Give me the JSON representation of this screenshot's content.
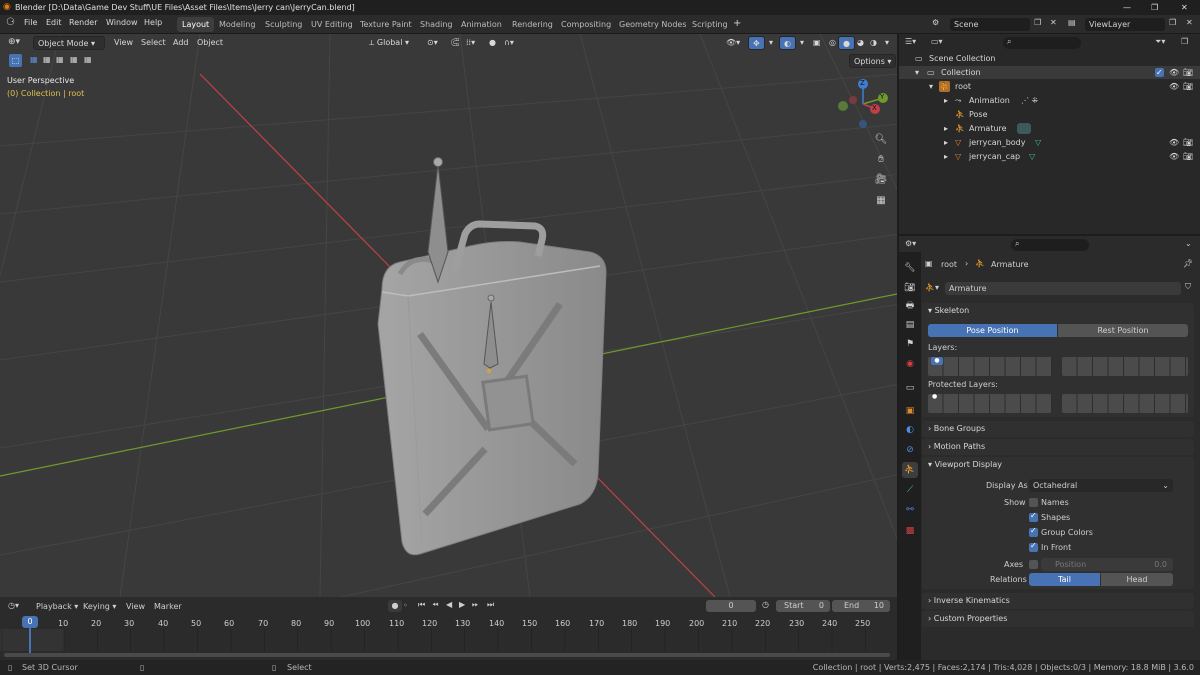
{
  "window": {
    "title": "Blender [D:\\Data\\Game Dev Stuff\\UE Files\\Asset Files\\Items\\Jerry can\\JerryCan.blend]"
  },
  "menu": [
    "File",
    "Edit",
    "Render",
    "Window",
    "Help"
  ],
  "workspaces": [
    "Layout",
    "Modeling",
    "Sculpting",
    "UV Editing",
    "Texture Paint",
    "Shading",
    "Animation",
    "Rendering",
    "Compositing",
    "Geometry Nodes",
    "Scripting"
  ],
  "scene": {
    "name": "Scene",
    "view_layer": "ViewLayer"
  },
  "viewport": {
    "mode": "Object Mode",
    "menus": [
      "View",
      "Select",
      "Add",
      "Object"
    ],
    "transform_orientation": "Global",
    "options": "Options",
    "perspective": "User Perspective",
    "context": "(0) Collection | root"
  },
  "gizmo": {
    "x": "X",
    "y": "Y",
    "z": "Z"
  },
  "outliner": {
    "scene_collection": "Scene Collection",
    "rows": [
      {
        "label": "Collection"
      },
      {
        "label": "root"
      },
      {
        "label": "Animation"
      },
      {
        "label": "Pose"
      },
      {
        "label": "Armature"
      },
      {
        "label": "jerrycan_body"
      },
      {
        "label": "jerrycan_cap"
      }
    ]
  },
  "properties": {
    "breadcrumb_object": "root",
    "breadcrumb_data": "Armature",
    "data_name": "Armature",
    "skeleton": {
      "title": "Skeleton",
      "pose_position": "Pose Position",
      "rest_position": "Rest Position",
      "layers": "Layers:",
      "protected_layers": "Protected Layers:"
    },
    "bone_groups": "Bone Groups",
    "motion_paths": "Motion Paths",
    "viewport_display": {
      "title": "Viewport Display",
      "display_as_label": "Display As",
      "display_as_value": "Octahedral",
      "show_label": "Show",
      "names": "Names",
      "shapes": "Shapes",
      "group_colors": "Group Colors",
      "in_front": "In Front",
      "axes_label": "Axes",
      "position_label": "Position",
      "position_value": "0.0",
      "relations_label": "Relations",
      "tail": "Tail",
      "head": "Head"
    },
    "inverse_kinematics": "Inverse Kinematics",
    "custom_properties": "Custom Properties"
  },
  "timeline": {
    "menus": [
      "Playback",
      "Keying",
      "View",
      "Marker"
    ],
    "current_frame": "0",
    "start_label": "Start",
    "start_value": "0",
    "end_label": "End",
    "end_value": "10",
    "ruler": [
      "0",
      "10",
      "20",
      "30",
      "40",
      "50",
      "60",
      "70",
      "80",
      "90",
      "100",
      "110",
      "120",
      "130",
      "140",
      "150",
      "160",
      "170",
      "180",
      "190",
      "200",
      "210",
      "220",
      "230",
      "240",
      "250"
    ]
  },
  "status": {
    "left_action": "Set 3D Cursor",
    "middle_action": "Select",
    "stats": "Collection | root | Verts:2,475 | Faces:2,174 | Tris:4,028 | Objects:0/3 | Memory: 18.8 MiB | 3.6.0"
  },
  "colors": {
    "accent": "#4772b3",
    "x_axis": "#c0404a",
    "y_axis": "#6f9a2c",
    "z_axis": "#3f7fd1",
    "active_tab": "#3d3d3d"
  }
}
